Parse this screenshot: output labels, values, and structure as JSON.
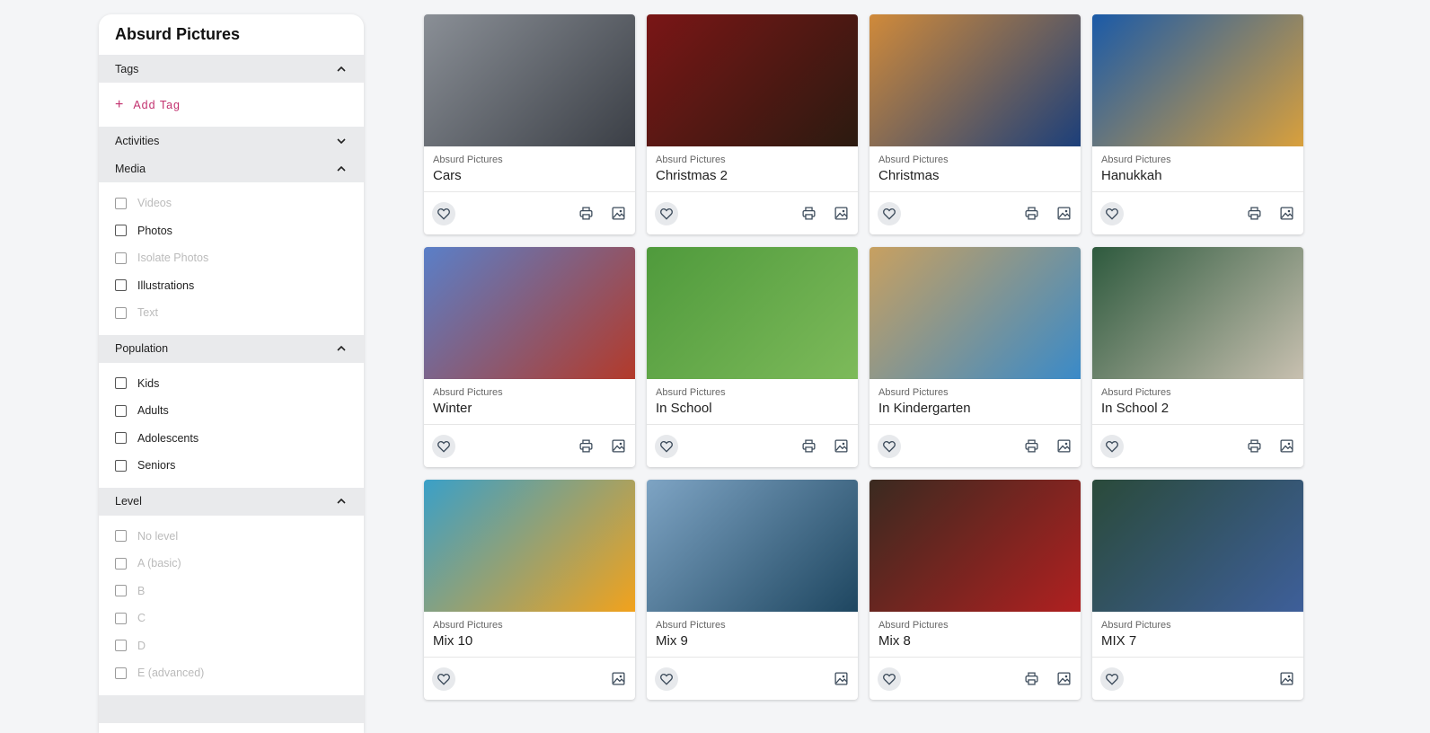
{
  "sidebar": {
    "title": "Absurd Pictures",
    "tags": {
      "label": "Tags",
      "add_label": "Add Tag"
    },
    "activities": {
      "label": "Activities"
    },
    "media": {
      "label": "Media",
      "options": [
        {
          "label": "Videos",
          "disabled": true
        },
        {
          "label": "Photos",
          "disabled": false
        },
        {
          "label": "Isolate Photos",
          "disabled": true
        },
        {
          "label": "Illustrations",
          "disabled": false
        },
        {
          "label": "Text",
          "disabled": true
        }
      ]
    },
    "population": {
      "label": "Population",
      "options": [
        {
          "label": "Kids",
          "disabled": false
        },
        {
          "label": "Adults",
          "disabled": false
        },
        {
          "label": "Adolescents",
          "disabled": false
        },
        {
          "label": "Seniors",
          "disabled": false
        }
      ]
    },
    "level": {
      "label": "Level",
      "options": [
        {
          "label": "No level",
          "disabled": true
        },
        {
          "label": "A (basic)",
          "disabled": true
        },
        {
          "label": "B",
          "disabled": true
        },
        {
          "label": "C",
          "disabled": true
        },
        {
          "label": "D",
          "disabled": true
        },
        {
          "label": "E (advanced)",
          "disabled": true
        }
      ]
    }
  },
  "cards": [
    {
      "category": "Absurd Pictures",
      "title": "Cars",
      "print": true,
      "colors": [
        "#8a8f96",
        "#3b3f46"
      ]
    },
    {
      "category": "Absurd Pictures",
      "title": "Christmas 2",
      "print": true,
      "colors": [
        "#7a1616",
        "#2b1a10"
      ]
    },
    {
      "category": "Absurd Pictures",
      "title": "Christmas",
      "print": true,
      "colors": [
        "#d08a3a",
        "#1c3f7a"
      ]
    },
    {
      "category": "Absurd Pictures",
      "title": "Hanukkah",
      "print": true,
      "colors": [
        "#1a5aa8",
        "#d9a03c"
      ]
    },
    {
      "category": "Absurd Pictures",
      "title": "Winter",
      "print": true,
      "colors": [
        "#5a7fc8",
        "#b33a2a"
      ]
    },
    {
      "category": "Absurd Pictures",
      "title": "In School",
      "print": true,
      "colors": [
        "#4f9a3c",
        "#7dba5a"
      ]
    },
    {
      "category": "Absurd Pictures",
      "title": "In Kindergarten",
      "print": true,
      "colors": [
        "#c8a060",
        "#3a8ac8"
      ]
    },
    {
      "category": "Absurd Pictures",
      "title": "In School 2",
      "print": true,
      "colors": [
        "#2e5a3e",
        "#c8c0b0"
      ]
    },
    {
      "category": "Absurd Pictures",
      "title": "Mix 10",
      "print": false,
      "colors": [
        "#3aa0c8",
        "#f2a21c"
      ]
    },
    {
      "category": "Absurd Pictures",
      "title": "Mix 9",
      "print": false,
      "colors": [
        "#7ea4c4",
        "#1e4660"
      ]
    },
    {
      "category": "Absurd Pictures",
      "title": "Mix 8",
      "print": true,
      "colors": [
        "#3a2a20",
        "#b02020"
      ]
    },
    {
      "category": "Absurd Pictures",
      "title": "MIX 7",
      "print": false,
      "colors": [
        "#2a4a3a",
        "#3e5f9a"
      ]
    }
  ],
  "icons": {
    "favorite": "heart-icon",
    "print": "printer-icon",
    "image": "image-icon",
    "expand": "chevron-up-icon",
    "collapse": "chevron-down-icon",
    "add": "plus-icon"
  }
}
